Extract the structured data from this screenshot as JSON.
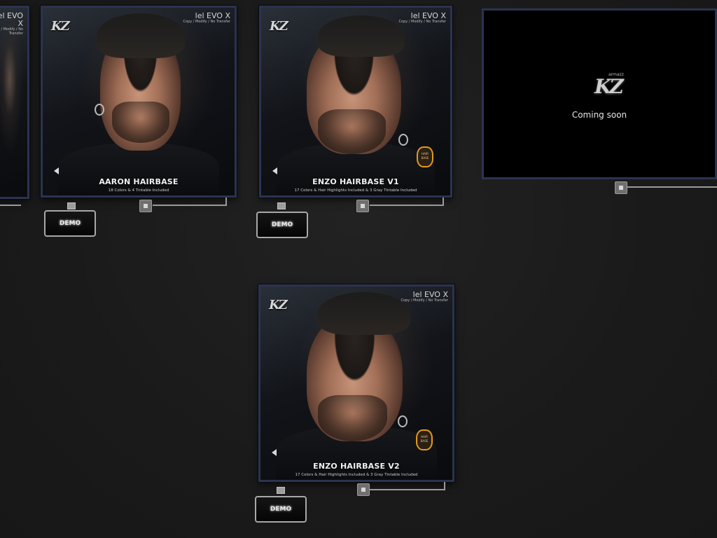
{
  "posters": [
    {
      "id": "left-partial",
      "evo_label": "lel EVO X",
      "evo_sub": "Copy / Modify / No Transfer"
    },
    {
      "id": "aaron",
      "evo_label": "lel EVO X",
      "evo_sub": "Copy / Modify / No Transfer",
      "title": "AARON HAIRBASE",
      "subtitle": "18 Colors & 4 Tintable Included",
      "logo_k": "K",
      "logo_z": "Z"
    },
    {
      "id": "enzo-v1",
      "evo_label": "lel EVO X",
      "evo_sub": "Copy / Modify / No Transfer",
      "title": "ENZO HAIRBASE V1",
      "subtitle": "17 Colors & Hair Highlights Included & 3 Gray Tintable Included",
      "logo_k": "K",
      "logo_z": "Z",
      "badge": "HAIR BASE"
    },
    {
      "id": "enzo-v2",
      "evo_label": "lel EVO X",
      "evo_sub": "Copy / Modify / No Transfer",
      "title": "ENZO HAIRBASE V2",
      "subtitle": "17 Colors & Hair Highlights Included & 3 Gray Tintable Included",
      "logo_k": "K",
      "logo_z": "Z",
      "badge": "HAIR BASE"
    }
  ],
  "coming_soon": {
    "logo_k": "K",
    "logo_z": "Z",
    "logo_small": "armazz",
    "text": "Coming soon"
  },
  "demo_label": "DEMO",
  "colors": {
    "frame": "#2b3350",
    "background": "#1b1b1b",
    "badge": "#e39a1c"
  }
}
